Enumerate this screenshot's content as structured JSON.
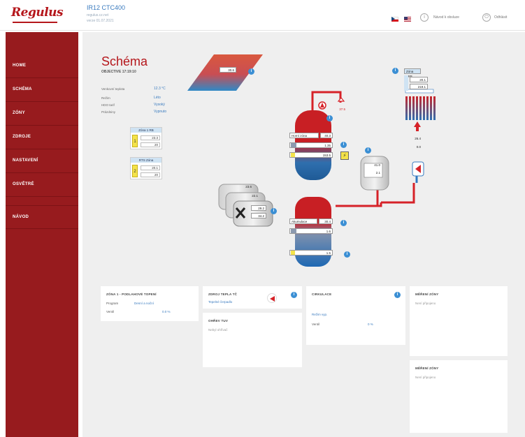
{
  "header": {
    "logo": "Regulus",
    "device_title": "IR12 CTC400",
    "device_sub1": "regulus.cz.net",
    "device_sub2": "verze 01.07.2021",
    "manual_label": "Návod k obsluze",
    "logout_label": "Odhlásit"
  },
  "sidebar": {
    "items": [
      {
        "label": "HOME"
      },
      {
        "label": "SCHÉMA"
      },
      {
        "label": "ZÓNY"
      },
      {
        "label": "ZDROJE"
      },
      {
        "label": "NASTAVENÍ"
      },
      {
        "label": "OSVĚTRÉ"
      },
      {
        "label": "NÁVOD"
      }
    ]
  },
  "page": {
    "title": "Schéma",
    "subtitle": "OBJECTIVE 17:19:10",
    "info": [
      {
        "key": "Venkovní teplota",
        "value": "12.3 °C"
      },
      {
        "key": "Režim",
        "value": "Léto"
      },
      {
        "key": "HDO tarif",
        "value": "Vysoký"
      },
      {
        "key": "Prázdniny",
        "value": "Vypnuto"
      }
    ]
  },
  "zones": [
    {
      "name": "Zóna 1 RB",
      "icon": "1",
      "actual": "23.3",
      "target": "20"
    },
    {
      "name": "RTS Zóna",
      "icon": "2",
      "actual": "20.1",
      "target": "20"
    }
  ],
  "schema": {
    "solar_value": "30.6",
    "hw_outlet": "37.5",
    "tank_label": "Horní zóna",
    "tank_top": "40.3",
    "tank_row2": "1.35",
    "tank_row3": "153.5",
    "valve_temp": "41.0",
    "valve_temp2": "2.1",
    "room_label": "Zóna 1RB",
    "room_val1": "20.1",
    "room_val2": "219.1",
    "floor_temp1": "26.4",
    "floor_temp2": "0.0",
    "hp_front1": "29.2",
    "hp_front2": "34.2",
    "hp_back1": "23.6",
    "hp_back2": "22.1",
    "buffer_label": "Akumulace",
    "buffer_top": "30.4",
    "buffer_row2": "1.6",
    "buffer_row3": "1.5"
  },
  "panels": {
    "zona1": {
      "title": "ZÓNA 1 - PODLAHOVÉ TOPENÍ",
      "k1": "Program",
      "v1": "Denní a noční",
      "k2": "Ventil",
      "v2": "0.0 %"
    },
    "zdrojtepla": {
      "title": "ZDROJ TEPLA TČ",
      "link": "Tepelné čerpadlo"
    },
    "ohrev": {
      "title": "OHŘEV TUV",
      "text": "Nebyl ohřívač"
    },
    "cirkulace": {
      "title": "CIRKULACE",
      "link": "Režim vyp.",
      "k": "Ventil",
      "v": "0 %"
    },
    "mereni1": {
      "title": "MĚŘENÍ ZÓNY",
      "text": "Není připojeno"
    },
    "mereni2": {
      "title": "MĚŘENÍ ZÓNY",
      "text": "Není připojeno"
    }
  },
  "colors": {
    "brand_red": "#b5161b",
    "sidebar": "#971b1e",
    "accent_blue": "#3a7bbf"
  }
}
